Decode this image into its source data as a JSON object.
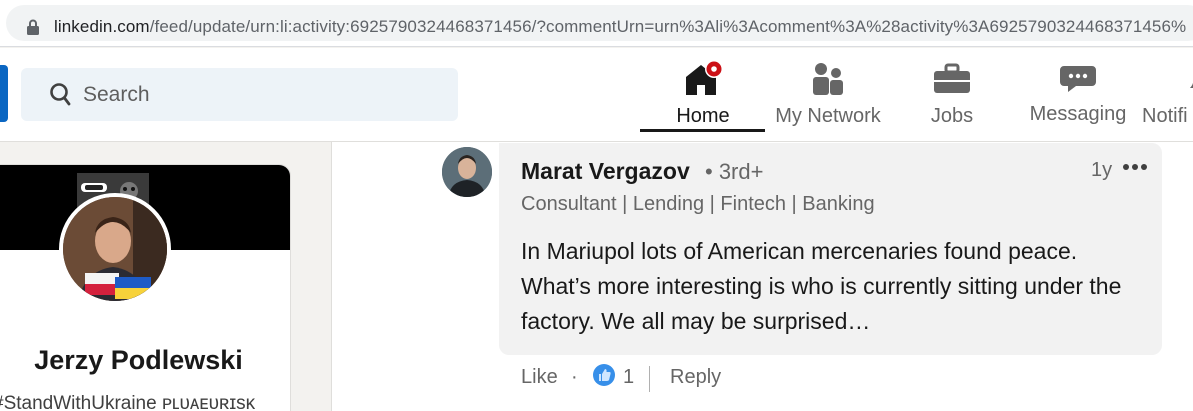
{
  "browser": {
    "url_host": "linkedin.com",
    "url_rest": "/feed/update/urn:li:activity:6925790324468371456/?commentUrn=urn%3Ali%3Acomment%3A%28activity%3A6925790324468371456%",
    "lock_icon": "lock-icon"
  },
  "nav": {
    "search_placeholder": "Search",
    "items": [
      {
        "label": "Home",
        "icon": "home-icon",
        "active": true
      },
      {
        "label": "My Network",
        "icon": "network-icon"
      },
      {
        "label": "Jobs",
        "icon": "briefcase-icon"
      },
      {
        "label": "Messaging",
        "icon": "messaging-icon"
      },
      {
        "label": "Notifi",
        "icon": "bell-icon"
      }
    ],
    "notification_color": "#cc1016"
  },
  "profile": {
    "name": "Jerzy Podlewski",
    "headline": "#StandWithUkraine ᴘʟᴜᴀᴇᴜʀɪsᴋ"
  },
  "comment": {
    "author": "Marat Vergazov",
    "degree": "• 3rd+",
    "time": "1y",
    "headline": "Consultant | Lending | Fintech | Banking",
    "text": "In Mariupol lots of American mercenaries found peace. What’s more interesting is who is currently sitting under the factory. We all may be surprised…",
    "actions": {
      "like": "Like",
      "dot": "·",
      "reaction_count": "1",
      "reply": "Reply"
    }
  },
  "colors": {
    "linkedin_blue": "#0a66c2",
    "reaction_blue": "#378fe9"
  }
}
